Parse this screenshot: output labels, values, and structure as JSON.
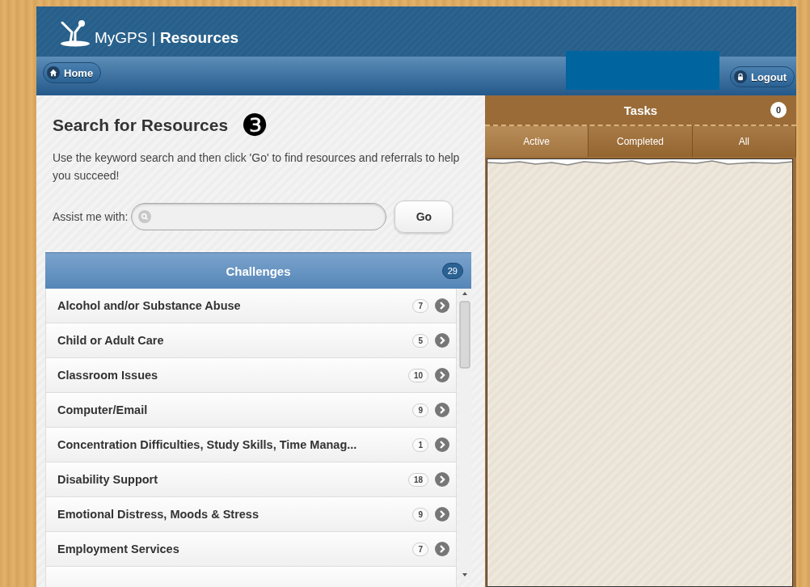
{
  "header": {
    "brand": "MyGPS",
    "separator": "|",
    "section": "Resources"
  },
  "nav": {
    "home_button": "Home",
    "logout_button": "Logout"
  },
  "search_panel": {
    "title": "Search for Resources",
    "step_marker": "❸",
    "description": "Use the keyword search and then click 'Go' to find resources and referrals to help you succeed!",
    "field_label": "Assist me with:",
    "go_button": "Go"
  },
  "challenges": {
    "title": "Challenges",
    "count": "29",
    "items": [
      {
        "label": "Alcohol and/or Substance Abuse",
        "count": "7"
      },
      {
        "label": "Child or Adult Care",
        "count": "5"
      },
      {
        "label": "Classroom Issues",
        "count": "10"
      },
      {
        "label": "Computer/Email",
        "count": "9"
      },
      {
        "label": "Concentration Difficulties, Study Skills, Time Manag...",
        "count": "1"
      },
      {
        "label": "Disability Support",
        "count": "18"
      },
      {
        "label": "Emotional Distress, Moods & Stress",
        "count": "9"
      },
      {
        "label": "Employment Services",
        "count": "7"
      }
    ]
  },
  "tasks": {
    "title": "Tasks",
    "count": "0",
    "tabs": [
      {
        "label": "Active",
        "selected": true
      },
      {
        "label": "Completed",
        "selected": false
      },
      {
        "label": "All",
        "selected": false
      }
    ]
  }
}
